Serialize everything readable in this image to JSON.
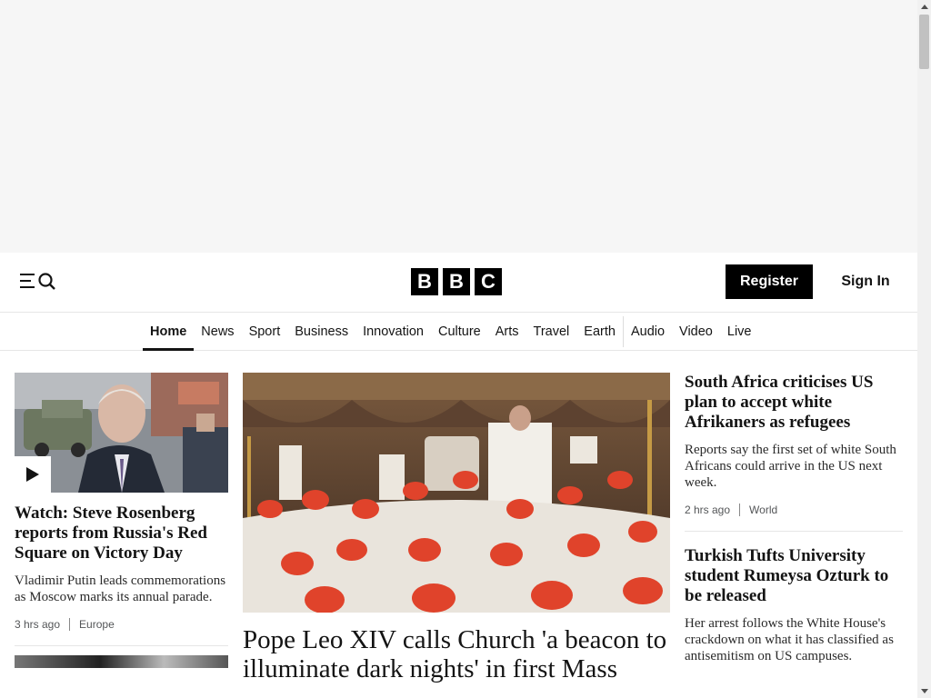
{
  "header": {
    "logo_letters": [
      "B",
      "B",
      "C"
    ],
    "register_label": "Register",
    "signin_label": "Sign In"
  },
  "nav": {
    "items": [
      {
        "label": "Home",
        "active": true
      },
      {
        "label": "News"
      },
      {
        "label": "Sport"
      },
      {
        "label": "Business"
      },
      {
        "label": "Innovation"
      },
      {
        "label": "Culture"
      },
      {
        "label": "Arts"
      },
      {
        "label": "Travel"
      },
      {
        "label": "Earth"
      },
      {
        "label": "Audio"
      },
      {
        "label": "Video"
      },
      {
        "label": "Live"
      }
    ]
  },
  "left_story": {
    "headline": "Watch: Steve Rosenberg reports from Russia's Red Square on Victory Day",
    "summary": "Vladimir Putin leads commemorations as Moscow marks its annual parade.",
    "time": "3 hrs ago",
    "section": "Europe"
  },
  "hero_story": {
    "headline": "Pope Leo XIV calls Church 'a beacon to illuminate dark nights' in first Mass"
  },
  "right_stories": [
    {
      "headline": "South Africa criticises US plan to accept white Afrikaners as refugees",
      "summary": "Reports say the first set of white South Africans could arrive in the US next week.",
      "time": "2 hrs ago",
      "section": "World"
    },
    {
      "headline": "Turkish Tufts University student Rumeysa Ozturk to be released",
      "summary": "Her arrest follows the White House's crackdown on what it has classified as antisemitism on US campuses."
    }
  ],
  "icons": {
    "menu": "menu-icon",
    "search": "search-icon",
    "play": "play-icon"
  }
}
